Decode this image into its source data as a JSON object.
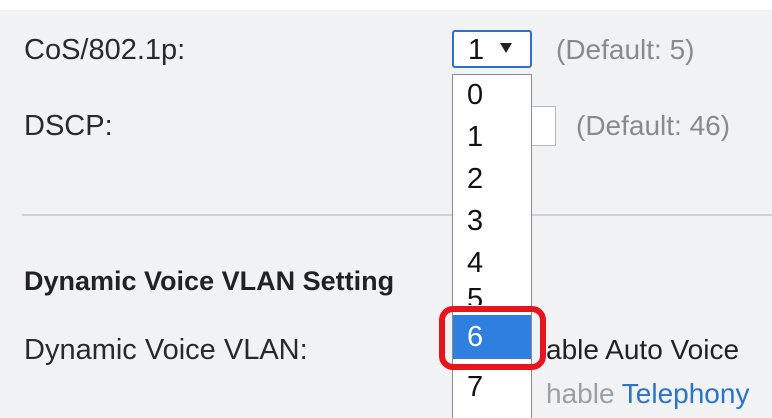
{
  "qos": {
    "cos_label": "CoS/802.1p:",
    "cos_selected": "1",
    "cos_default": "(Default: 5)",
    "dscp_label": "DSCP:",
    "dscp_default": "(Default: 46)"
  },
  "dropdown": {
    "options": [
      "0",
      "1",
      "2",
      "3",
      "4",
      "5",
      "6",
      "7"
    ],
    "highlighted": "6"
  },
  "dynamic": {
    "section_title": "Dynamic Voice VLAN Setting",
    "row_label": "Dynamic Voice VLAN:",
    "option_auto": "able Auto Voice",
    "option_tel_prefix": "hable ",
    "option_tel_link": "Telephony"
  },
  "colors": {
    "highlight_border": "#e8141b",
    "selected_option": "#2f7fe0",
    "link": "#2a74c9"
  }
}
